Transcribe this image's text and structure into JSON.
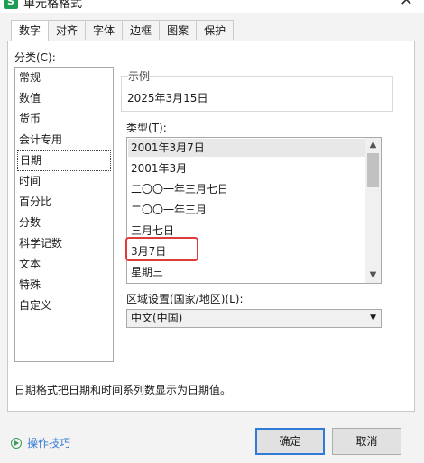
{
  "window": {
    "title": "单元格格式",
    "app_icon": "S"
  },
  "tabs": [
    "数字",
    "对齐",
    "字体",
    "边框",
    "图案",
    "保护"
  ],
  "category": {
    "label": "分类(C):",
    "items": [
      "常规",
      "数值",
      "货币",
      "会计专用",
      "日期",
      "时间",
      "百分比",
      "分数",
      "科学记数",
      "文本",
      "特殊",
      "自定义"
    ],
    "selected": "日期"
  },
  "sample": {
    "label": "示例",
    "value": "2025年3月15日"
  },
  "type": {
    "label": "类型(T):",
    "items": [
      "2001年3月7日",
      "2001年3月",
      "二〇〇一年三月七日",
      "二〇〇一年三月",
      "三月七日",
      "3月7日",
      "星期三"
    ],
    "highlighted": "2001年3月7日",
    "annotated": "3月7日"
  },
  "locale": {
    "label": "区域设置(国家/地区)(L):",
    "value": "中文(中国)"
  },
  "description": "日期格式把日期和时间系列数显示为日期值。",
  "footer": {
    "help_label": "操作技巧",
    "ok_label": "确定",
    "cancel_label": "取消"
  },
  "colors": {
    "ok_border": "#2f7bd6",
    "annotation": "#e03b3b",
    "help_link": "#3a7bd5",
    "app_icon": "#1e9e55"
  }
}
